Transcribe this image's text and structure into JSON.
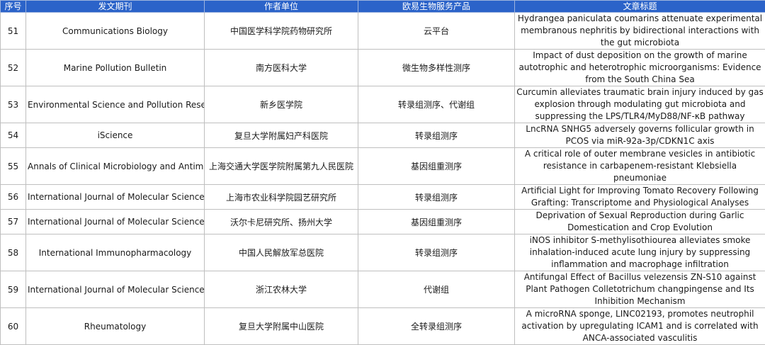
{
  "table": {
    "headers": [
      "序号",
      "发文期刊",
      "作者单位",
      "欧易生物服务产品",
      "文章标题"
    ],
    "rows": [
      {
        "no": "51",
        "journal": "Communications Biology",
        "affiliation": "中国医学科学院药物研究所",
        "service": "云平台",
        "title": "Hydrangea paniculata coumarins attenuate experimental membranous nephritis by bidirectional interactions with the gut microbiota"
      },
      {
        "no": "52",
        "journal": "Marine Pollution Bulletin",
        "affiliation": "南方医科大学",
        "service": "微生物多样性测序",
        "title": "Impact of dust deposition on the growth of marine autotrophic and heterotrophic microorganisms: Evidence from the South China Sea"
      },
      {
        "no": "53",
        "journal": "Environmental Science and Pollution Research",
        "affiliation": "新乡医学院",
        "service": "转录组测序、代谢组",
        "title": "Curcumin alleviates traumatic brain injury induced by gas explosion through modulating gut microbiota and suppressing the LPS/TLR4/MyD88/NF-κB pathway"
      },
      {
        "no": "54",
        "journal": "iScience",
        "affiliation": "复旦大学附属妇产科医院",
        "service": "转录组测序",
        "title": "LncRNA SNHG5 adversely governs follicular growth in PCOS via miR-92a-3p/CDKN1C axis"
      },
      {
        "no": "55",
        "journal": "Annals of Clinical Microbiology and Antimicrobials",
        "affiliation": "上海交通大学医学院附属第九人民医院",
        "service": "基因组重测序",
        "title": "A critical role of outer membrane vesicles in antibiotic resistance in carbapenem-resistant Klebsiella pneumoniae"
      },
      {
        "no": "56",
        "journal": "International Journal of Molecular Sciences",
        "affiliation": "上海市农业科学院园艺研究所",
        "service": "转录组测序",
        "title": "Artificial Light for Improving Tomato Recovery Following Grafting: Transcriptome and Physiological Analyses"
      },
      {
        "no": "57",
        "journal": "International Journal of Molecular Sciences",
        "affiliation": "沃尔卡尼研究所、扬州大学",
        "service": "基因组重测序",
        "title": "Deprivation of Sexual Reproduction during Garlic Domestication and Crop Evolution"
      },
      {
        "no": "58",
        "journal": "International Immunopharmacology",
        "affiliation": "中国人民解放军总医院",
        "service": "转录组测序",
        "title": "iNOS inhibitor S-methylisothiourea alleviates smoke inhalation-induced acute lung injury by suppressing inflammation and macrophage infiltration"
      },
      {
        "no": "59",
        "journal": "International Journal of Molecular Sciences",
        "affiliation": "浙江农林大学",
        "service": "代谢组",
        "title": "Antifungal Effect of Bacillus velezensis ZN-S10 against Plant Pathogen Colletotrichum changpingense and Its Inhibition Mechanism"
      },
      {
        "no": "60",
        "journal": "Rheumatology",
        "affiliation": "复旦大学附属中山医院",
        "service": "全转录组测序",
        "title": "A microRNA sponge, LINC02193, promotes neutrophil activation by upregulating ICAM1 and is correlated with ANCA-associated vasculitis"
      }
    ]
  }
}
